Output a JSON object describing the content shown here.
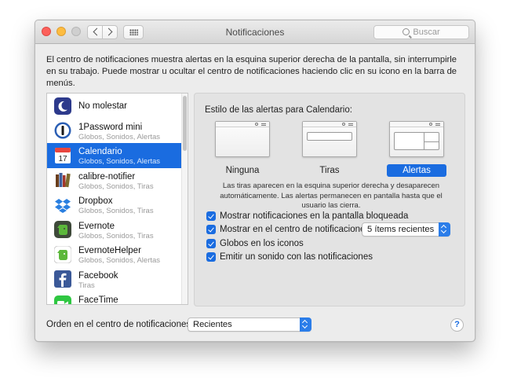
{
  "window": {
    "title": "Notificaciones",
    "search_placeholder": "Buscar"
  },
  "description": "El centro de notificaciones muestra alertas en la esquina superior derecha de la pantalla, sin interrumpirle en su trabajo. Puede mostrar u ocultar el centro de notificaciones haciendo clic en su icono en la barra de menús.",
  "apps": [
    {
      "name": "No molestar",
      "sub": "",
      "icon": "moon-icon"
    },
    {
      "name": "1Password mini",
      "sub": "Globos, Sonidos, Alertas",
      "icon": "1password-icon"
    },
    {
      "name": "Calendario",
      "sub": "Globos, Sonidos, Alertas",
      "icon": "calendar-icon",
      "selected": true
    },
    {
      "name": "calibre-notifier",
      "sub": "Globos, Sonidos, Tiras",
      "icon": "books-icon"
    },
    {
      "name": "Dropbox",
      "sub": "Globos, Sonidos, Tiras",
      "icon": "dropbox-icon"
    },
    {
      "name": "Evernote",
      "sub": "Globos, Sonidos, Tiras",
      "icon": "evernote-icon"
    },
    {
      "name": "EvernoteHelper",
      "sub": "Globos, Sonidos, Alertas",
      "icon": "evernote-icon"
    },
    {
      "name": "Facebook",
      "sub": "Tiras",
      "icon": "facebook-icon"
    },
    {
      "name": "FaceTime",
      "sub": "",
      "icon": "facetime-icon"
    }
  ],
  "calendar_icon_day": "17",
  "panel": {
    "title": "Estilo de las alertas para Calendario:",
    "styles": {
      "none": "Ninguna",
      "banners": "Tiras",
      "alerts": "Alertas"
    },
    "help_text": "Las tiras aparecen en la esquina superior derecha y desaparecen automáticamente. Las alertas permanecen en pantalla hasta que el usuario las cierra.",
    "options": {
      "lock_screen": "Mostrar notificaciones en la pantalla bloqueada",
      "show_in_center": "Mostrar en el centro de notificaciones:",
      "badges": "Globos en los iconos",
      "sound": "Emitir un sonido con las notificaciones"
    },
    "recent_items_value": "5 ítems recientes"
  },
  "footer": {
    "order_label": "Orden en el centro de notificaciones:",
    "order_value": "Recientes",
    "help_glyph": "?"
  },
  "colors": {
    "accent": "#1a6ce0"
  }
}
